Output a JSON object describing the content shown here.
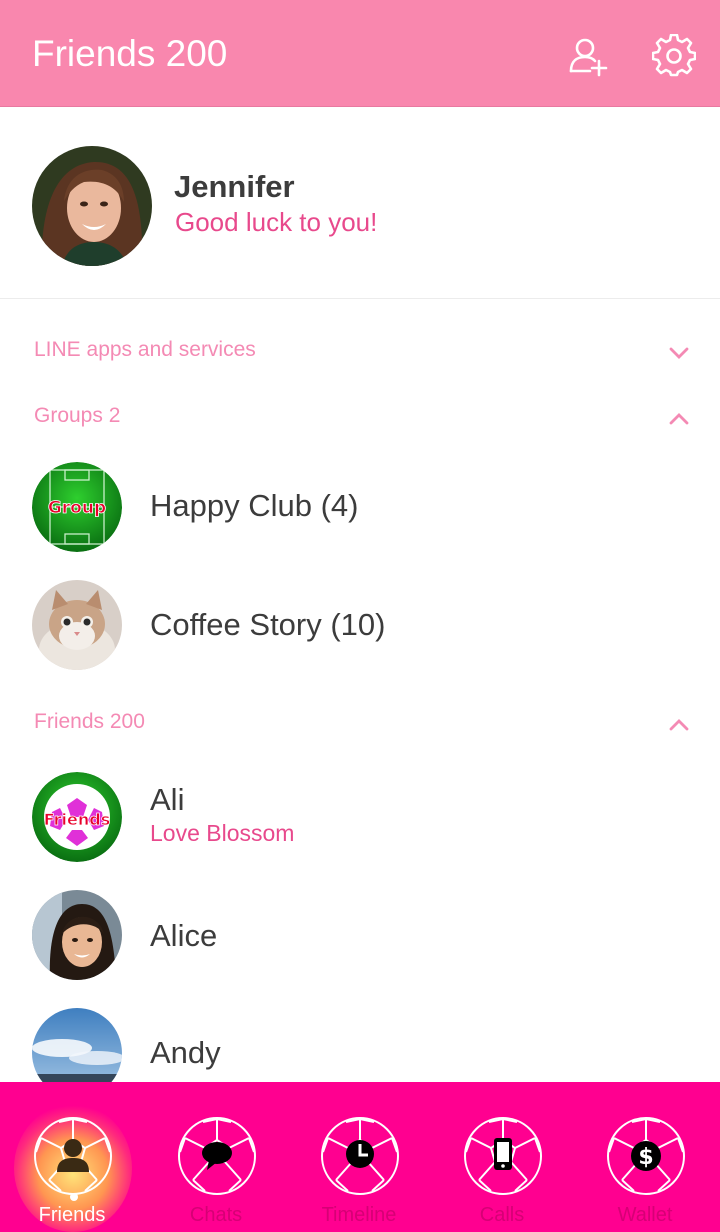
{
  "colors": {
    "header": "#f987ae",
    "accent": "#e8498c",
    "section": "#f48ab4",
    "tabbar": "#ff0090"
  },
  "header": {
    "title": "Friends 200",
    "add_friend_icon": "add-friend-icon",
    "settings_icon": "gear-icon"
  },
  "profile": {
    "name": "Jennifer",
    "status": "Good luck to you!",
    "avatar_icon": "profile-photo"
  },
  "sections": {
    "services": {
      "label": "LINE apps and services",
      "expanded": false
    },
    "groups": {
      "label": "Groups 2",
      "expanded": true,
      "items": [
        {
          "name": "Happy Club (4)",
          "avatar_text": "Group"
        },
        {
          "name": "Coffee Story (10)"
        }
      ]
    },
    "friends": {
      "label": "Friends 200",
      "expanded": true,
      "items": [
        {
          "name": "Ali",
          "status": "Love Blossom",
          "avatar_text": "Friends"
        },
        {
          "name": "Alice"
        },
        {
          "name": "Andy"
        }
      ]
    }
  },
  "tabs": [
    {
      "label": "Friends",
      "icon": "person-icon",
      "active": true
    },
    {
      "label": "Chats",
      "icon": "chat-bubble-icon",
      "active": false
    },
    {
      "label": "Timeline",
      "icon": "clock-icon",
      "active": false
    },
    {
      "label": "Calls",
      "icon": "phone-icon",
      "active": false
    },
    {
      "label": "Wallet",
      "icon": "dollar-icon",
      "active": false
    }
  ]
}
